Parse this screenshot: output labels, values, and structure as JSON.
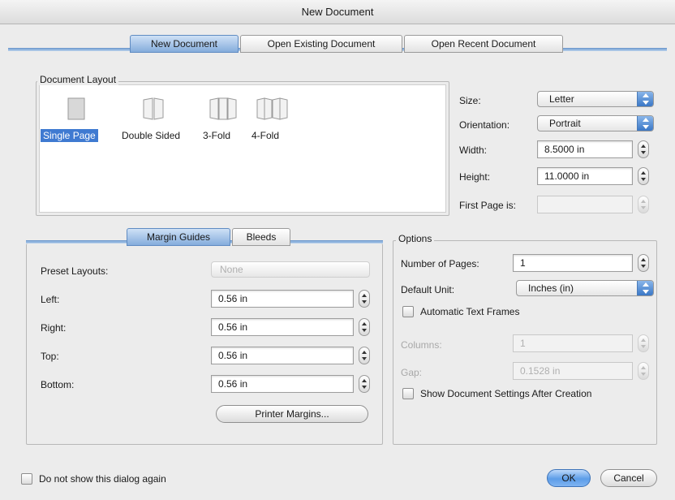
{
  "window": {
    "title": "New Document"
  },
  "tabs": [
    {
      "label": "New Document",
      "active": true
    },
    {
      "label": "Open Existing Document",
      "active": false
    },
    {
      "label": "Open Recent Document",
      "active": false
    }
  ],
  "document_layout": {
    "label": "Document Layout",
    "options": [
      {
        "label": "Single Page",
        "icon": "single-page-icon",
        "selected": true
      },
      {
        "label": "Double Sided",
        "icon": "double-sided-icon",
        "selected": false
      },
      {
        "label": "3-Fold",
        "icon": "three-fold-icon",
        "selected": false
      },
      {
        "label": "4-Fold",
        "icon": "four-fold-icon",
        "selected": false
      }
    ]
  },
  "page_settings": {
    "size": {
      "label": "Size:",
      "value": "Letter"
    },
    "orientation": {
      "label": "Orientation:",
      "value": "Portrait"
    },
    "width": {
      "label": "Width:",
      "value": "8.5000 in"
    },
    "height": {
      "label": "Height:",
      "value": "11.0000 in"
    },
    "first_page": {
      "label": "First Page is:",
      "value": ""
    }
  },
  "margin_tabs": [
    {
      "label": "Margin Guides",
      "active": true
    },
    {
      "label": "Bleeds",
      "active": false
    }
  ],
  "margins": {
    "preset": {
      "label": "Preset Layouts:",
      "value": "None"
    },
    "left": {
      "label": "Left:",
      "value": "0.56 in"
    },
    "right": {
      "label": "Right:",
      "value": "0.56 in"
    },
    "top": {
      "label": "Top:",
      "value": "0.56 in"
    },
    "bottom": {
      "label": "Bottom:",
      "value": "0.56 in"
    },
    "printer_margins_button": "Printer Margins..."
  },
  "options": {
    "label": "Options",
    "number_of_pages": {
      "label": "Number of Pages:",
      "value": "1"
    },
    "default_unit": {
      "label": "Default Unit:",
      "value": "Inches (in)"
    },
    "automatic_text_frames": {
      "label": "Automatic Text Frames",
      "checked": false
    },
    "columns": {
      "label": "Columns:",
      "value": "1"
    },
    "gap": {
      "label": "Gap:",
      "value": "0.1528 in"
    },
    "show_settings": {
      "label": "Show Document Settings After Creation",
      "checked": false
    }
  },
  "footer": {
    "do_not_show": {
      "label": "Do not show this dialog again",
      "checked": false
    },
    "ok": "OK",
    "cancel": "Cancel"
  },
  "colors": {
    "accent": "#3f7ad1",
    "tab_active": "#84acdc",
    "tab_line": "#8fb4de"
  }
}
